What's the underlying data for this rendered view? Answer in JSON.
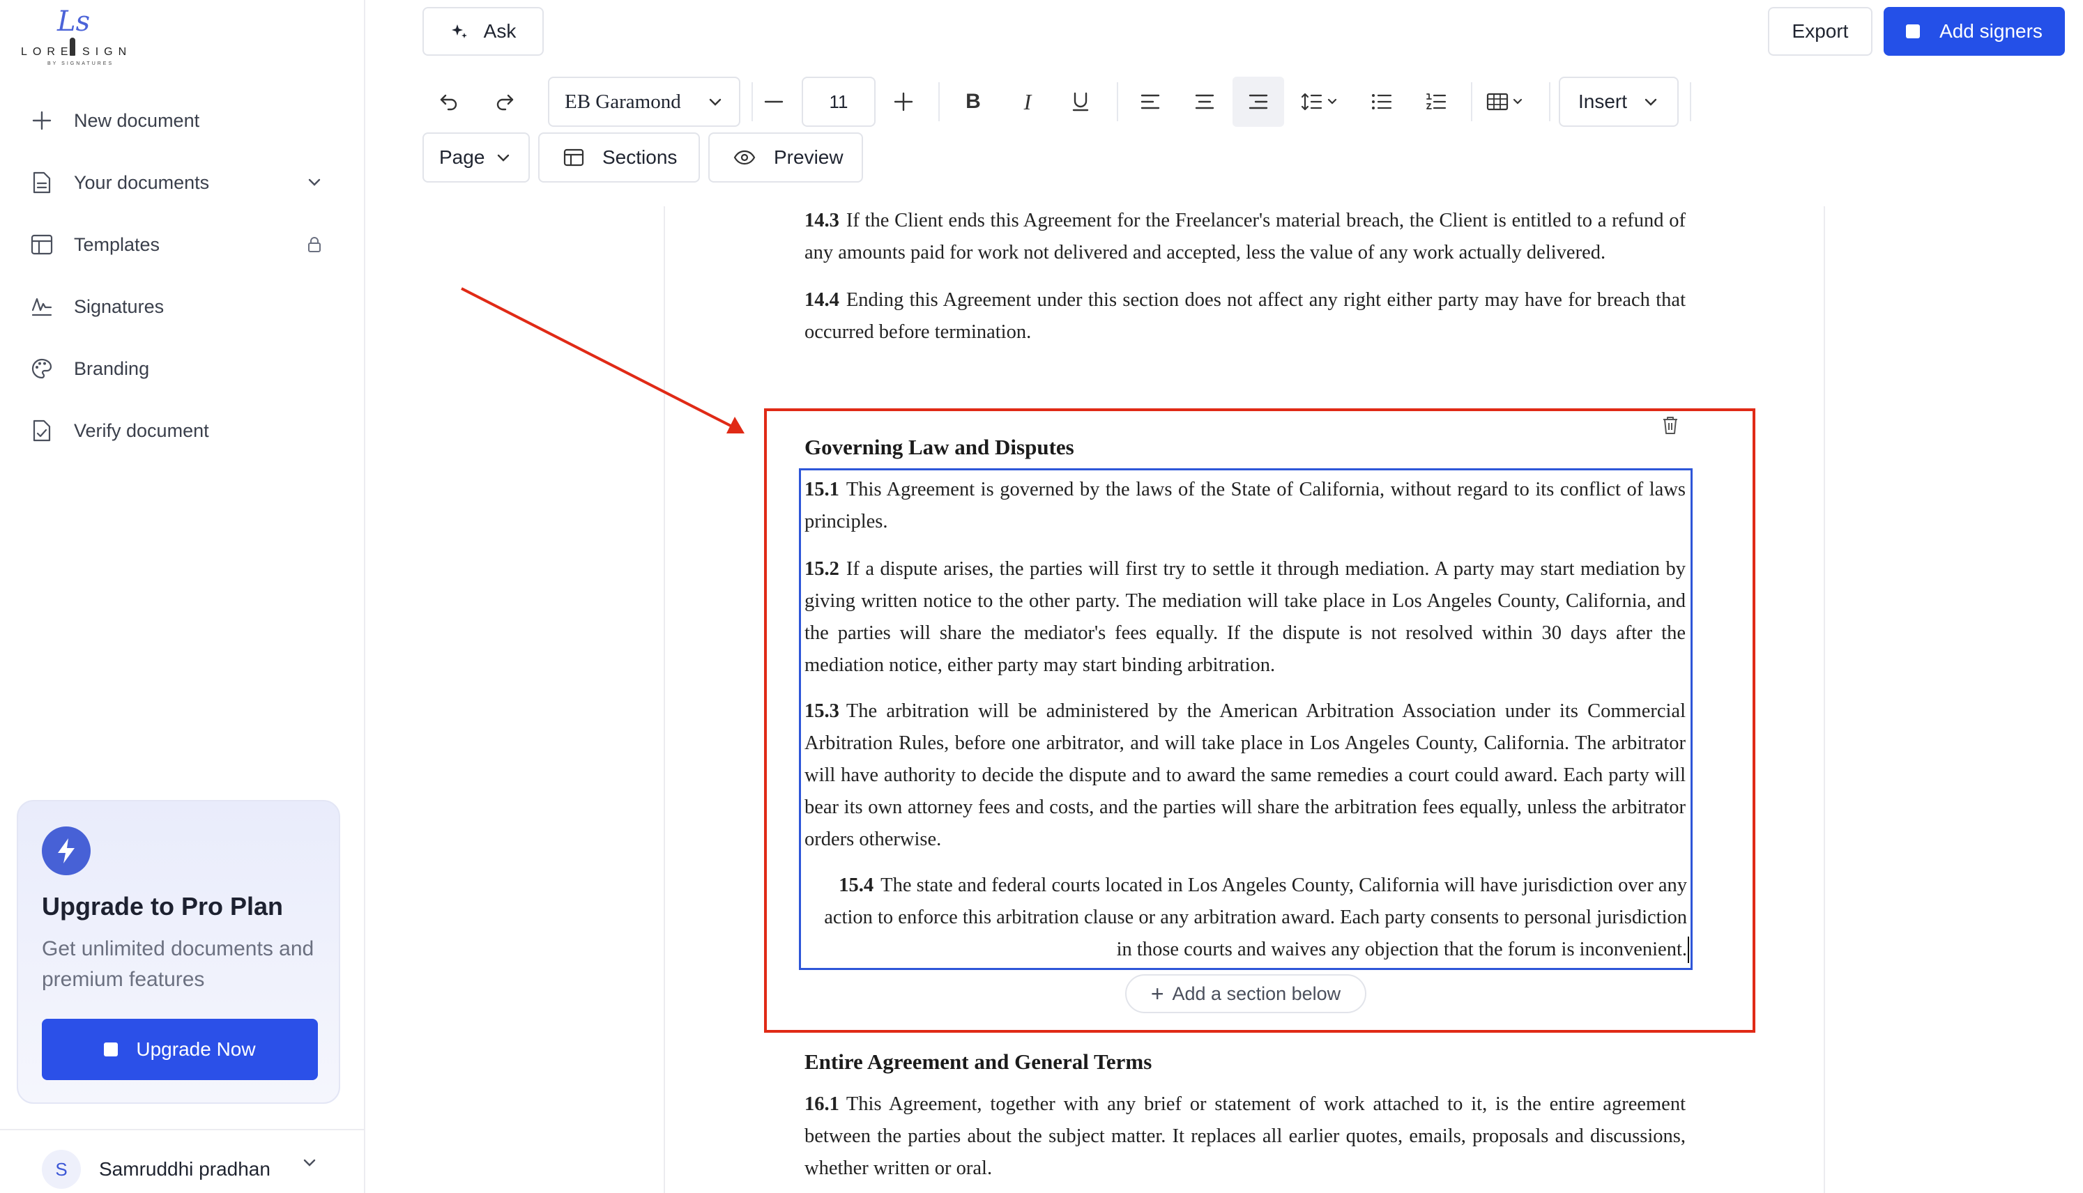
{
  "brand": {
    "logo_monogram": "Ls",
    "logo_text": "LORE SIGN",
    "logo_subtext": "BY SIGNATURES"
  },
  "sidebar": {
    "items": [
      {
        "label": "New document",
        "icon": "plus-icon"
      },
      {
        "label": "Your documents",
        "icon": "document-icon",
        "trailing": "chevron-down-icon"
      },
      {
        "label": "Templates",
        "icon": "template-icon",
        "trailing": "lock-icon"
      },
      {
        "label": "Signatures",
        "icon": "signature-icon"
      },
      {
        "label": "Branding",
        "icon": "palette-icon"
      },
      {
        "label": "Verify document",
        "icon": "verify-document-icon"
      }
    ],
    "promo": {
      "title": "Upgrade to Pro Plan",
      "description": "Get unlimited documents and premium features",
      "button": "Upgrade Now"
    },
    "user": {
      "initial": "S",
      "name": "Samruddhi pradhan"
    }
  },
  "header": {
    "ask": "Ask",
    "export": "Export",
    "add_signers": "Add signers"
  },
  "toolbar": {
    "font_family": "EB Garamond",
    "font_size": "11",
    "insert": "Insert",
    "page": "Page",
    "sections": "Sections",
    "preview": "Preview"
  },
  "document": {
    "paragraphs_top": [
      {
        "num": "14.3",
        "text": "If the Client ends this Agreement for the Freelancer's material breach, the Client is entitled to a refund of any amounts paid for work not delivered and accepted, less the value of any work actually delivered."
      },
      {
        "num": "14.4",
        "text": "Ending this Agreement under this section does not affect any right either party may have for breach that occurred before termination."
      }
    ],
    "selected_section": {
      "heading": "Governing Law and Disputes",
      "paragraphs": [
        {
          "num": "15.1",
          "text": "This Agreement is governed by the laws of the State of California, without regard to its conflict of laws principles."
        },
        {
          "num": "15.2",
          "text": "If a dispute arises, the parties will first try to settle it through mediation. A party may start mediation by giving written notice to the other party. The mediation will take place in Los Angeles County, California, and the parties will share the mediator's fees equally. If the dispute is not resolved within 30 days after the mediation notice, either party may start binding arbitration."
        },
        {
          "num": "15.3",
          "text": "The arbitration will be administered by the American Arbitration Association under its Commercial Arbitration Rules, before one arbitrator, and will take place in Los Angeles County, California. The arbitrator will have authority to decide the dispute and to award the same remedies a court could award. Each party will bear its own attorney fees and costs, and the parties will share the arbitration fees equally, unless the arbitrator orders otherwise."
        },
        {
          "num": "15.4",
          "text": "The state and federal courts located in Los Angeles County, California will have jurisdiction over any action to enforce this arbitration clause or any arbitration award. Each party consents to personal jurisdiction in those courts and waives any objection that the forum is inconvenient."
        }
      ],
      "add_section_label": "Add a section below"
    },
    "next_section": {
      "heading": "Entire Agreement and General Terms",
      "paragraphs": [
        {
          "num": "16.1",
          "text": "This Agreement, together with any brief or statement of work attached to it, is the entire agreement between the parties about the subject matter. It replaces all earlier quotes, emails, proposals and discussions, whether written or oral."
        }
      ]
    }
  },
  "colors": {
    "accent": "#2450e8",
    "annotation_red": "#e02a16",
    "selection_blue": "#2e56d8"
  }
}
